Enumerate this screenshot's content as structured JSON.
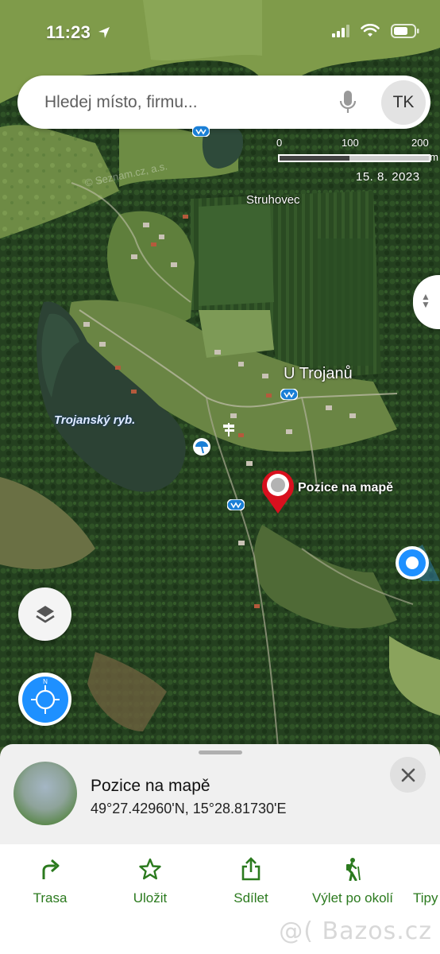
{
  "status_bar": {
    "time": "11:23"
  },
  "search": {
    "placeholder": "Hledej místo, firmu...",
    "avatar_initials": "TK"
  },
  "map": {
    "scale_ticks": [
      "0",
      "100",
      "200"
    ],
    "scale_unit": "m",
    "imagery_date": "15. 8. 2023",
    "watermark": "© Seznam.cz, a.s.",
    "labels": {
      "village_north": "Struhovec",
      "village_main": "U Trojanů",
      "lake": "Trojanský ryb.",
      "pin": "Pozice na mapě"
    }
  },
  "sheet": {
    "title": "Pozice na mapě",
    "coordinates": "49°27.42960'N, 15°28.81730'E"
  },
  "actions": [
    {
      "label": "Trasa",
      "icon": "route-arrow-icon"
    },
    {
      "label": "Uložit",
      "icon": "star-icon"
    },
    {
      "label": "Sdílet",
      "icon": "share-icon"
    },
    {
      "label": "Výlet po okolí",
      "icon": "hiker-icon"
    },
    {
      "label": "Tipy",
      "icon": "tips-icon"
    }
  ],
  "footer": {
    "watermark": "@( Bazos.cz"
  },
  "colors": {
    "accent_green": "#2b7a1e",
    "pin_red": "#d8101e",
    "location_blue": "#1e90ff"
  }
}
